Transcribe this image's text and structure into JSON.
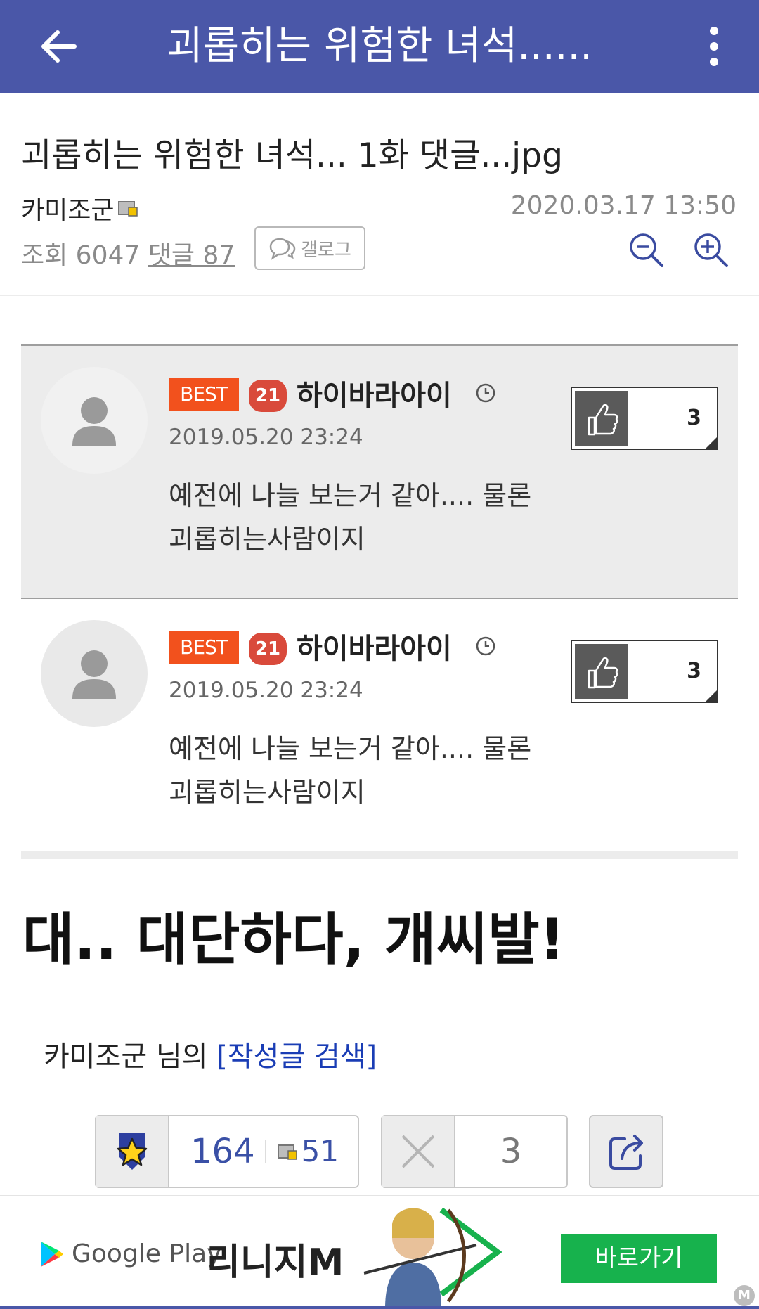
{
  "appbar": {
    "title": "괴롭히는 위험한 녀석......",
    "bg_color": "#4a57a8"
  },
  "post": {
    "title": "괴롭히는 위험한 녀석... 1화 댓글...jpg",
    "author": "카미조군",
    "date": "2020.03.17 13:50",
    "views_label": "조회 6047",
    "comments_label": "댓글 87",
    "gallog_label": "갤로그"
  },
  "comments": [
    {
      "badge": "BEST",
      "level": "21",
      "nickname": "하이바라아이",
      "date": "2019.05.20 23:24",
      "text": "예전에 나늘 보는거 같아.... 물론 괴롭히는사람이지",
      "likes": "3"
    },
    {
      "badge": "BEST",
      "level": "21",
      "nickname": "하이바라아이",
      "date": "2019.05.20 23:24",
      "text": "예전에 나늘 보는거 같아.... 물론 괴롭히는사람이지",
      "likes": "3"
    }
  ],
  "body": {
    "headline": "대.. 대단하다, 개씨발!",
    "author_prefix": "카미조군 님의 ",
    "search_link": "[작성글 검색]"
  },
  "votes": {
    "up": "164",
    "up_fixed": "51",
    "down": "3"
  },
  "ad": {
    "store": "Google Play",
    "game": "리니지M",
    "cta": "바로가기",
    "badge": "M"
  }
}
